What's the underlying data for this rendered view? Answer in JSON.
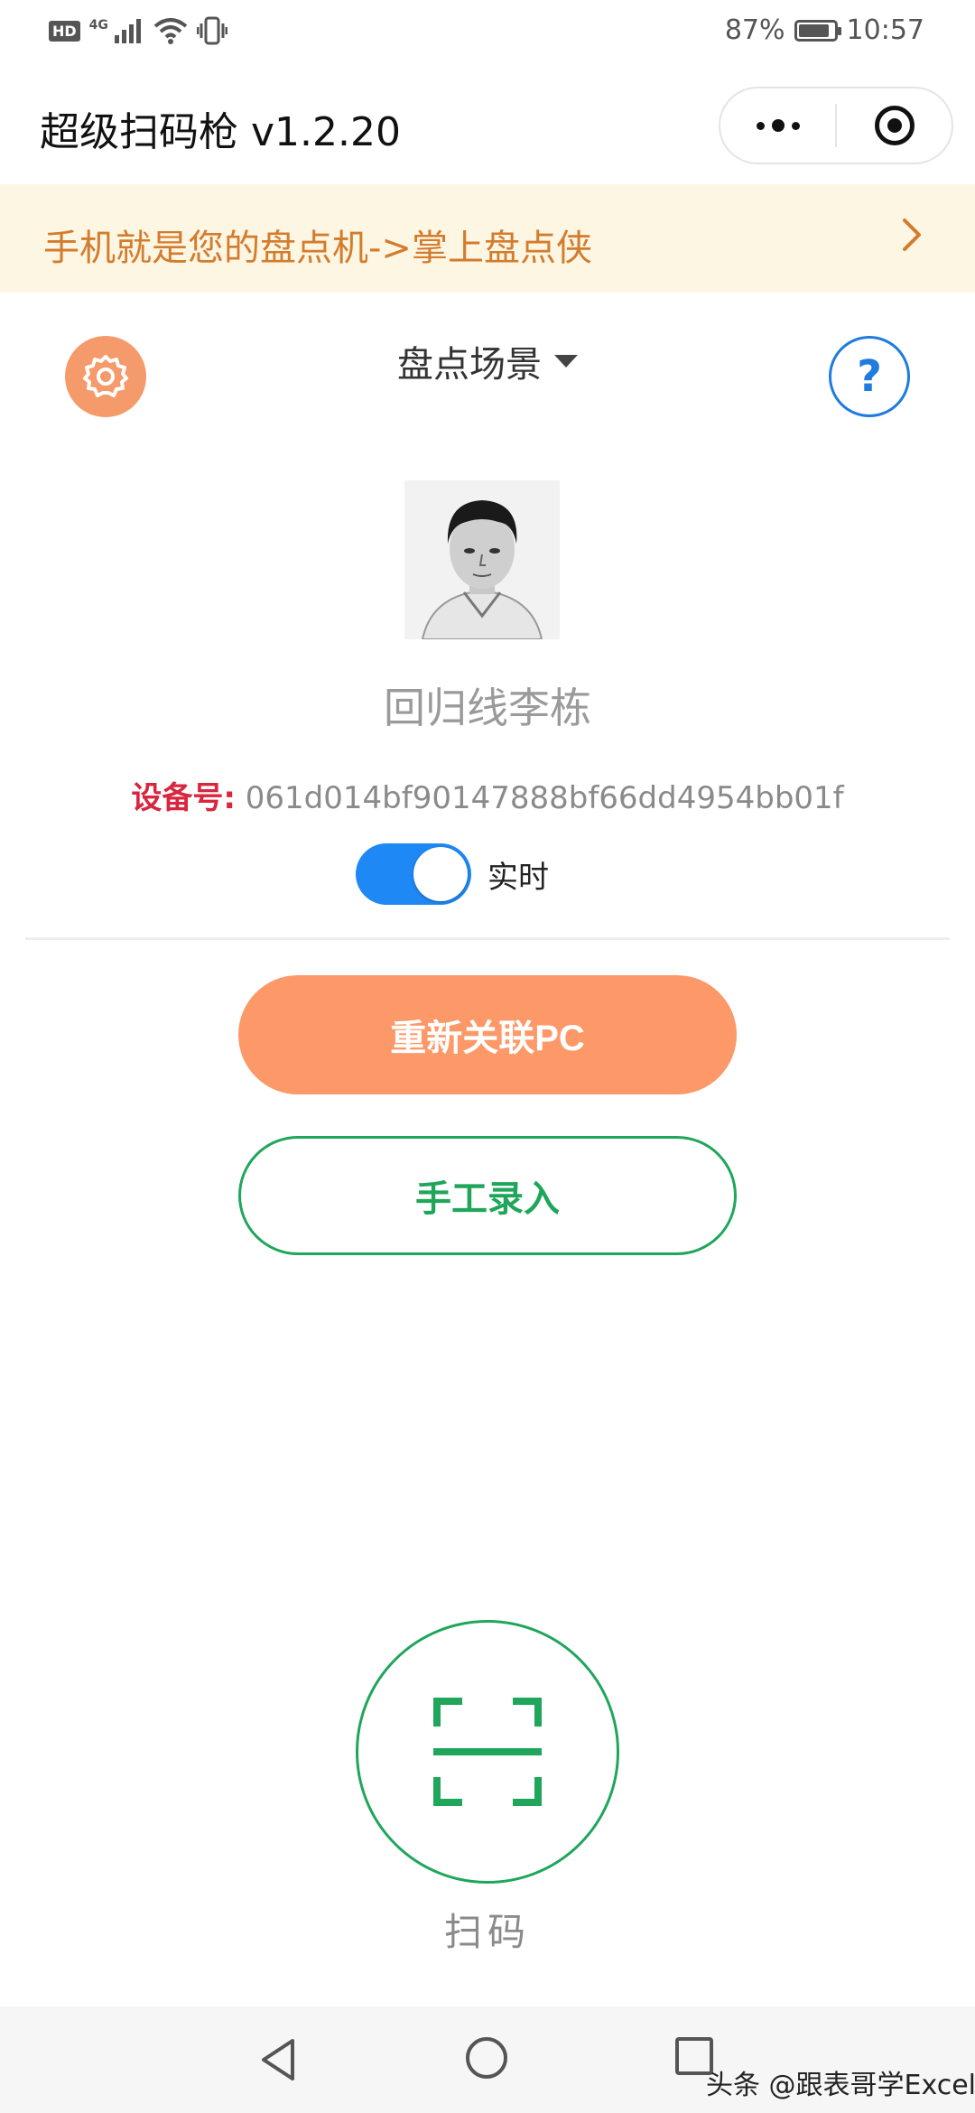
{
  "status_bar": {
    "hd": "HD",
    "network": "4G",
    "battery_percent": "87%",
    "battery_level": 0.87,
    "time": "10:57",
    "icons": [
      "signal-icon",
      "wifi-icon",
      "vibrate-icon",
      "battery-icon"
    ]
  },
  "nav": {
    "title": "超级扫码枪 v1.2.20",
    "icons": [
      "more-icon",
      "close-target-icon"
    ]
  },
  "banner": {
    "text": "手机就是您的盘点机->掌上盘点侠",
    "icon": "chevron-right-icon"
  },
  "header": {
    "scene": "盘点场景",
    "help": "?",
    "icons": [
      "gear-icon",
      "caret-down-icon",
      "help-icon"
    ]
  },
  "user": {
    "name": "回归线李栋"
  },
  "device": {
    "label": "设备号:",
    "id": "061d014bf90147888bf66dd4954bb01f"
  },
  "realtime": {
    "label": "实时",
    "enabled": true
  },
  "buttons": {
    "relink": "重新关联PC",
    "manual": "手工录入"
  },
  "scan": {
    "label": "扫码",
    "icon": "scan-icon"
  },
  "system_nav": {
    "icons": [
      "back-icon",
      "home-icon",
      "recent-apps-icon"
    ],
    "watermark": "头条 @跟表哥学Excel"
  },
  "colors": {
    "accent_orange": "#fd9868",
    "accent_green": "#1fa65a",
    "accent_blue": "#1e88f5",
    "banner_bg": "#fdf6e3",
    "banner_text": "#d37c2d",
    "device_label": "#d7263d"
  }
}
